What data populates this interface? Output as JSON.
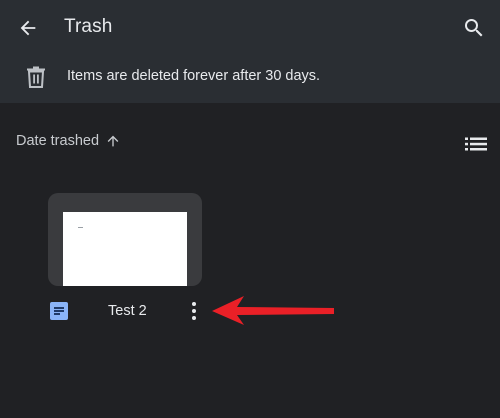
{
  "header": {
    "title": "Trash",
    "back_icon": "arrow-back-icon",
    "search_icon": "search-icon"
  },
  "notice": {
    "icon": "trash-icon",
    "text": "Items are deleted forever after 30 days."
  },
  "sort": {
    "label": "Date trashed",
    "direction_icon": "arrow-up-icon",
    "view_icon": "list-view-icon"
  },
  "files": [
    {
      "name": "Test 2",
      "type_icon": "google-docs-icon",
      "more_icon": "more-vert-icon"
    }
  ],
  "colors": {
    "background": "#202124",
    "header_background": "#2a2e33",
    "text": "#e8eaed",
    "doc_icon": "#8ab4f8",
    "annotation_arrow": "#ea2027"
  }
}
